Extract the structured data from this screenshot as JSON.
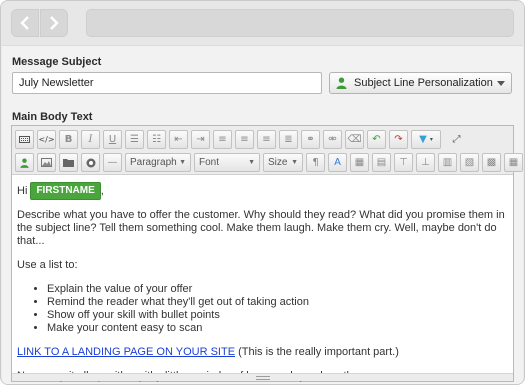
{
  "form": {
    "subject_label": "Message Subject",
    "subject_value": "July Newsletter",
    "personalization_label": "Subject Line Personalization",
    "body_label": "Main Body Text"
  },
  "toolbar": {
    "paragraph_select": "Paragraph",
    "font_select": "Font",
    "size_select": "Size",
    "icons_row1": [
      "keyboard-icon",
      "source-code-icon",
      "bold-icon",
      "italic-icon",
      "underline-icon",
      "unordered-list-icon",
      "ordered-list-icon",
      "outdent-icon",
      "indent-icon",
      "align-left-icon",
      "align-center-icon",
      "align-right-icon",
      "align-justify-icon",
      "link-icon",
      "unlink-icon",
      "clear-format-icon",
      "undo-icon",
      "redo-icon",
      "color-dropdown-icon",
      "fullscreen-icon"
    ],
    "icons_row2": [
      "personalize-user-icon",
      "image-icon",
      "folder-icon",
      "record-icon",
      "horizontal-rule-icon"
    ]
  },
  "body": {
    "greeting": "Hi",
    "merge_tag": "FIRSTNAME",
    "greeting_end": ",",
    "paragraph1": "Describe what you have to offer the customer. Why should they read? What did you promise them in the subject line? Tell them something cool. Make them laugh. Make them cry. Well, maybe don't do that...",
    "list_intro": "Use a list to:",
    "list_items": [
      "Explain the value of your offer",
      "Remind the reader what they'll get out of taking action",
      "Show off your skill with bullet points",
      "Make your content easy to scan"
    ],
    "link_text": "LINK TO A LANDING PAGE ON YOUR SITE",
    "link_note": " (This is the really important part.)",
    "closing": "Now wrap it all up with a pithy little reminder of how much you love them."
  },
  "colors": {
    "merge_tag_bg": "#4aa53d",
    "link": "#1a3fd8",
    "person_icon": "#3f9a3a"
  }
}
